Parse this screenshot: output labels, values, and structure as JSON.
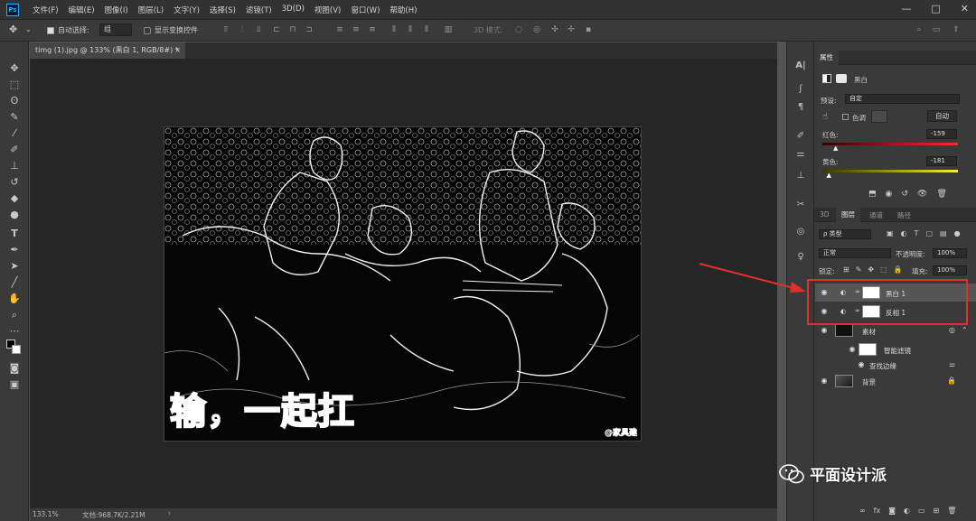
{
  "app": {
    "logo": "Ps"
  },
  "menu": [
    "文件(F)",
    "编辑(E)",
    "图像(I)",
    "图层(L)",
    "文字(Y)",
    "选择(S)",
    "滤镜(T)",
    "3D(D)",
    "视图(V)",
    "窗口(W)",
    "帮助(H)"
  ],
  "window_controls": [
    "—",
    "□",
    "✕"
  ],
  "options": {
    "auto_select_label": "自动选择:",
    "auto_select_value": "组",
    "show_transform_label": "显示变换控件",
    "mode_3d_label": "3D 模式:"
  },
  "document": {
    "tab_title": "timg (1).jpg @ 133% (黑白 1, RGB/8#) *",
    "caption": "输，一起扛",
    "watermark_corner": "@家具建"
  },
  "status": {
    "zoom": "133.1%",
    "doc_size": "文档:968.7K/2.21M",
    "more": "›"
  },
  "properties": {
    "tab": "属性",
    "adjustment_name": "黑白",
    "preset_label": "预设:",
    "preset_value": "自定",
    "tint_label": "色调",
    "auto_button": "自动",
    "reds_label": "红色:",
    "reds_value": "-159",
    "reds_fraction": 0.1,
    "yellows_label": "黄色:",
    "yellows_value": "-181",
    "yellows_fraction": 0.05
  },
  "layers_panel": {
    "tabs": [
      "3D",
      "图层",
      "通道",
      "路径"
    ],
    "active_tab": "图层",
    "filter_label": "ρ 类型",
    "blend_mode": "正常",
    "opacity_label": "不透明度:",
    "opacity_value": "100%",
    "lock_label": "锁定:",
    "fill_label": "填充:",
    "fill_value": "100%",
    "layers": [
      {
        "name": "黑白 1",
        "kind": "adjustment",
        "selected": true
      },
      {
        "name": "反相 1",
        "kind": "adjustment",
        "selected": false
      },
      {
        "name": "素材",
        "kind": "smart",
        "selected": false
      },
      {
        "name": "智能滤镜",
        "kind": "filter-mask",
        "selected": false
      },
      {
        "name": "查找边缘",
        "kind": "filter",
        "selected": false
      },
      {
        "name": "背景",
        "kind": "background",
        "selected": false
      }
    ],
    "footer_icons": [
      "link-icon",
      "fx-icon",
      "mask-icon",
      "adjustment-icon",
      "group-icon",
      "new-layer-icon",
      "delete-icon"
    ]
  },
  "watermark": {
    "text": "平面设计派"
  },
  "colors": {
    "highlight": "#e0302c",
    "accent": "#31a8ff"
  }
}
